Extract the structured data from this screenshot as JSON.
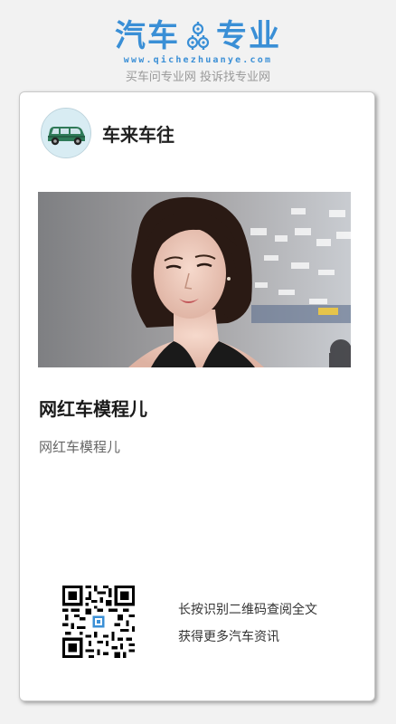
{
  "header": {
    "logo_left": "汽车",
    "logo_right": "专业",
    "url": "www.qichezhuanye.com",
    "slogan": "买车问专业网 投诉找专业网"
  },
  "card": {
    "account_name": "车来车往",
    "article_title": "网红车模程儿",
    "article_summary": "网红车模程儿",
    "qr_line1": "长按识别二维码查阅全文",
    "qr_line2": "获得更多汽车资讯"
  },
  "colors": {
    "brand_blue": "#3a8fd6",
    "background": "#f2f2f2",
    "card": "#ffffff"
  }
}
